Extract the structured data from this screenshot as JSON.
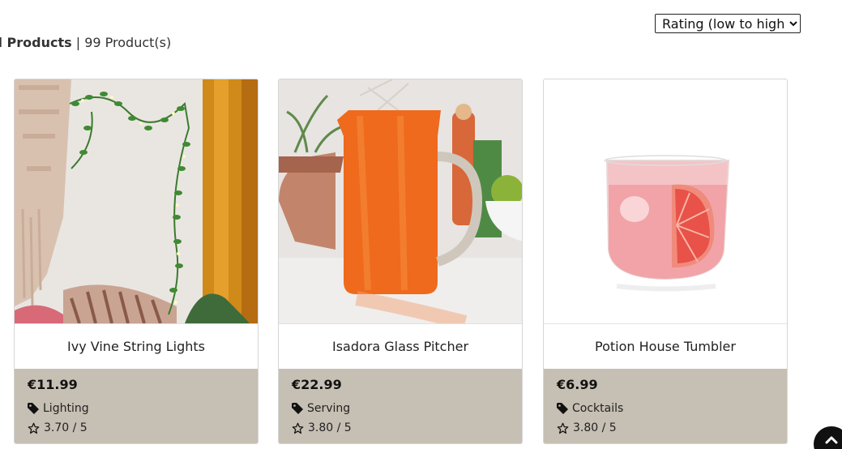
{
  "sort": {
    "selected": "Rating (low to high)"
  },
  "heading": {
    "title": "ll Products",
    "separator": " | ",
    "count": "99 Product(s)"
  },
  "products": [
    {
      "name": "Ivy Vine String Lights",
      "price": "€11.99",
      "category": "Lighting",
      "rating": "3.70 / 5",
      "image": "ivy-vine-lights-photo"
    },
    {
      "name": "Isadora Glass Pitcher",
      "price": "€22.99",
      "category": "Serving",
      "rating": "3.80 / 5",
      "image": "orange-glass-pitcher-photo"
    },
    {
      "name": "Potion House Tumbler",
      "price": "€6.99",
      "category": "Cocktails",
      "rating": "3.80 / 5",
      "image": "grapefruit-cocktail-tumbler-photo"
    }
  ],
  "icons": {
    "category": "tag-icon",
    "rating": "star-outline-icon",
    "scroll": "chevron-up-icon"
  },
  "colors": {
    "info_panel": "#c6bfb3",
    "scroll_button": "#111111"
  }
}
